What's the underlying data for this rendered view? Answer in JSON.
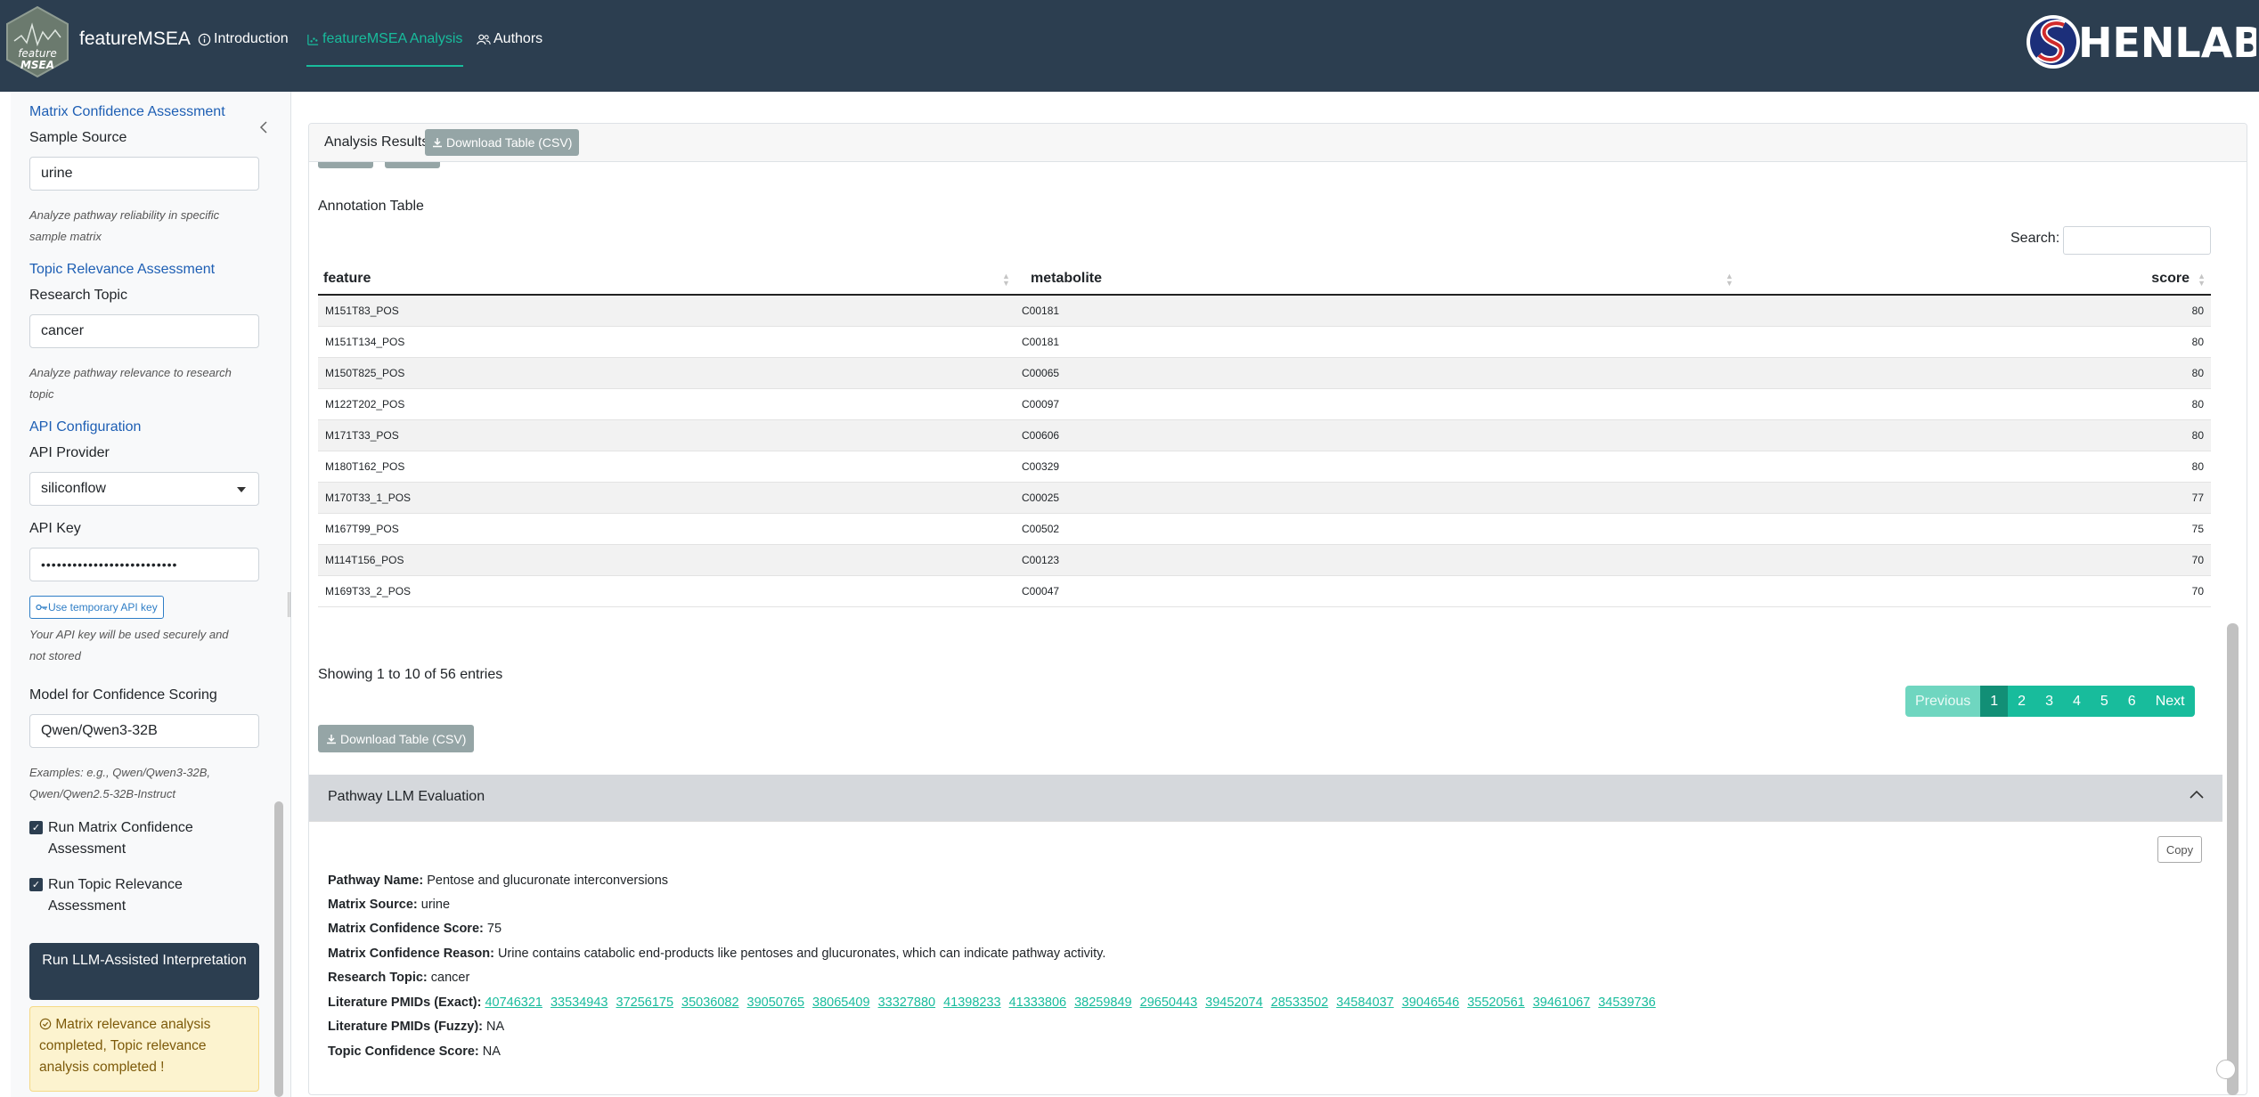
{
  "navbar": {
    "logo_text_top": "feature",
    "logo_text_bottom": "MSEA",
    "brand": "featureMSEA",
    "links": [
      {
        "label": "Introduction",
        "icon": "info-circle-icon"
      },
      {
        "label": "featureMSEA Analysis",
        "icon": "chart-icon",
        "active": true
      },
      {
        "label": "Authors",
        "icon": "users-icon"
      }
    ],
    "partner_logo_text": "HENLAB",
    "colors": {
      "bg": "#2c3e50",
      "accent": "#18bc9c"
    }
  },
  "sidebar": {
    "matrix_heading": "Matrix Confidence Assessment",
    "sample_source_label": "Sample Source",
    "sample_source_value": "urine",
    "sample_source_help": "Analyze pathway reliability in specific sample matrix",
    "topic_heading": "Topic Relevance Assessment",
    "research_topic_label": "Research Topic",
    "research_topic_value": "cancer",
    "research_topic_help": "Analyze pathway relevance to research topic",
    "api_heading": "API Configuration",
    "api_provider_label": "API Provider",
    "api_provider_value": "siliconflow",
    "api_key_label": "API Key",
    "api_key_value": "••••••••••••••••••••••••••",
    "temp_key_button": "Use temporary API key",
    "api_key_help": "Your API key will be used securely and not stored",
    "model_label": "Model for Confidence Scoring",
    "model_value": "Qwen/Qwen3-32B",
    "model_help": "Examples: e.g., Qwen/Qwen3-32B, Qwen/Qwen2.5-32B-Instruct",
    "check_matrix": "Run Matrix Confidence Assessment",
    "check_topic": "Run Topic Relevance Assessment",
    "run_button": "Run LLM-Assisted Interpretation",
    "status": "Matrix relevance analysis completed, Topic relevance analysis completed !"
  },
  "results": {
    "card_title": "Analysis Results",
    "download_label": "Download Table (CSV)",
    "annotation_title": "Annotation Table",
    "search_label": "Search:",
    "columns": [
      "feature",
      "metabolite",
      "score"
    ],
    "rows": [
      [
        "M151T83_POS",
        "C00181",
        "80"
      ],
      [
        "M151T134_POS",
        "C00181",
        "80"
      ],
      [
        "M150T825_POS",
        "C00065",
        "80"
      ],
      [
        "M122T202_POS",
        "C00097",
        "80"
      ],
      [
        "M171T33_POS",
        "C00606",
        "80"
      ],
      [
        "M180T162_POS",
        "C00329",
        "80"
      ],
      [
        "M170T33_1_POS",
        "C00025",
        "77"
      ],
      [
        "M167T99_POS",
        "C00502",
        "75"
      ],
      [
        "M114T156_POS",
        "C00123",
        "70"
      ],
      [
        "M169T33_2_POS",
        "C00047",
        "70"
      ]
    ],
    "info": "Showing 1 to 10 of 56 entries",
    "pager": [
      "Previous",
      "1",
      "2",
      "3",
      "4",
      "5",
      "6",
      "Next"
    ]
  },
  "evaluation": {
    "title": "Pathway LLM Evaluation",
    "copy_label": "Copy",
    "pathway_name_label": "Pathway Name:",
    "pathway_name": "Pentose and glucuronate interconversions",
    "matrix_source_label": "Matrix Source:",
    "matrix_source": "urine",
    "matrix_score_label": "Matrix Confidence Score:",
    "matrix_score": "75",
    "matrix_reason_label": "Matrix Confidence Reason:",
    "matrix_reason": "Urine contains catabolic end-products like pentoses and glucuronates, which can indicate pathway activity.",
    "topic_label": "Research Topic:",
    "topic": "cancer",
    "pmids_exact_label": "Literature PMIDs (Exact):",
    "pmids_exact": [
      "40746321",
      "33534943",
      "37256175",
      "35036082",
      "39050765",
      "38065409",
      "33327880",
      "41398233",
      "41333806",
      "38259849",
      "29650443",
      "39452074",
      "28533502",
      "34584037",
      "39046546",
      "35520561",
      "39461067",
      "34539736"
    ],
    "pmids_fuzzy_label": "Literature PMIDs (Fuzzy):",
    "pmids_fuzzy": "NA",
    "topic_score_label": "Topic Confidence Score:",
    "topic_score": "NA"
  }
}
